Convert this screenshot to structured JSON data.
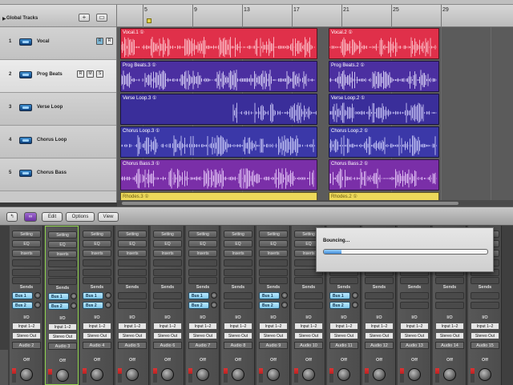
{
  "global_tracks": {
    "label": "Global Tracks",
    "plus": "+"
  },
  "ruler": {
    "bars": [
      "5",
      "9",
      "13",
      "17",
      "21",
      "25",
      "29"
    ]
  },
  "tracks": [
    {
      "number": "1",
      "name": "Vocal",
      "selected": false
    },
    {
      "number": "2",
      "name": "Prog Beats",
      "selected": true
    },
    {
      "number": "3",
      "name": "Verse Loop",
      "selected": false
    },
    {
      "number": "4",
      "name": "Chorus Loop",
      "selected": false
    },
    {
      "number": "5",
      "name": "Chorus Bass",
      "selected": false
    }
  ],
  "track_buttons": {
    "R": "R",
    "M": "M",
    "S": "S"
  },
  "regions": {
    "vocal_1": "Vocal.1 ①",
    "vocal_2": "Vocal.2 ①",
    "prog_3": "Prog Beats.3 ①",
    "prog_2": "Prog Beats.2 ①",
    "verse_3": "Verse Loop.3 ①",
    "verse_2": "Verse Loop.2 ①",
    "chorus_3": "Chorus Loop.3 ①",
    "chorus_2": "Chorus Loop.2 ①",
    "bass_3": "Chorus Bass.3 ①",
    "bass_2": "Chorus Bass.2 ①",
    "rhodes_3": "Rhodes.3 ①",
    "rhodes_2": "Rhodes.2 ①"
  },
  "colors": {
    "vocal": "#e0304a",
    "prog": "#4b2fa0",
    "verse": "#3a2e9a",
    "chorus": "#3b38a8",
    "bass": "#7a2fa8",
    "rhodes": "#ecd85a"
  },
  "mixer_toolbar": {
    "edit": "Edit",
    "options": "Options",
    "view": "View"
  },
  "strip_labels": {
    "setting": "Setting",
    "eq": "EQ",
    "inserts": "Inserts",
    "sends": "Sends",
    "io": "I/O",
    "input": "Input 1–2",
    "output": "Stereo Out",
    "off": "Off",
    "bus1": "Bus 1",
    "bus2": "Bus 2"
  },
  "strips": [
    {
      "name": "Audio 2",
      "buses": true,
      "selected": false
    },
    {
      "name": "Audio 3",
      "buses": true,
      "selected": true
    },
    {
      "name": "Audio 4",
      "buses": true,
      "selected": false
    },
    {
      "name": "Audio 5",
      "buses": false,
      "selected": false
    },
    {
      "name": "Audio 6",
      "buses": false,
      "selected": false
    },
    {
      "name": "Audio 7",
      "buses": true,
      "selected": false
    },
    {
      "name": "Audio 8",
      "buses": false,
      "selected": false
    },
    {
      "name": "Audio 9",
      "buses": true,
      "selected": false
    },
    {
      "name": "Audio 10",
      "buses": false,
      "selected": false
    },
    {
      "name": "Audio 11",
      "buses": true,
      "selected": false
    },
    {
      "name": "Audio 12",
      "buses": false,
      "selected": false
    },
    {
      "name": "Audio 13",
      "buses": false,
      "selected": false
    },
    {
      "name": "Audio 14",
      "buses": false,
      "selected": false
    },
    {
      "name": "Audio 15",
      "buses": false,
      "selected": false
    }
  ],
  "bounce_dialog": {
    "title": "Bouncing…",
    "progress": 0.11
  }
}
